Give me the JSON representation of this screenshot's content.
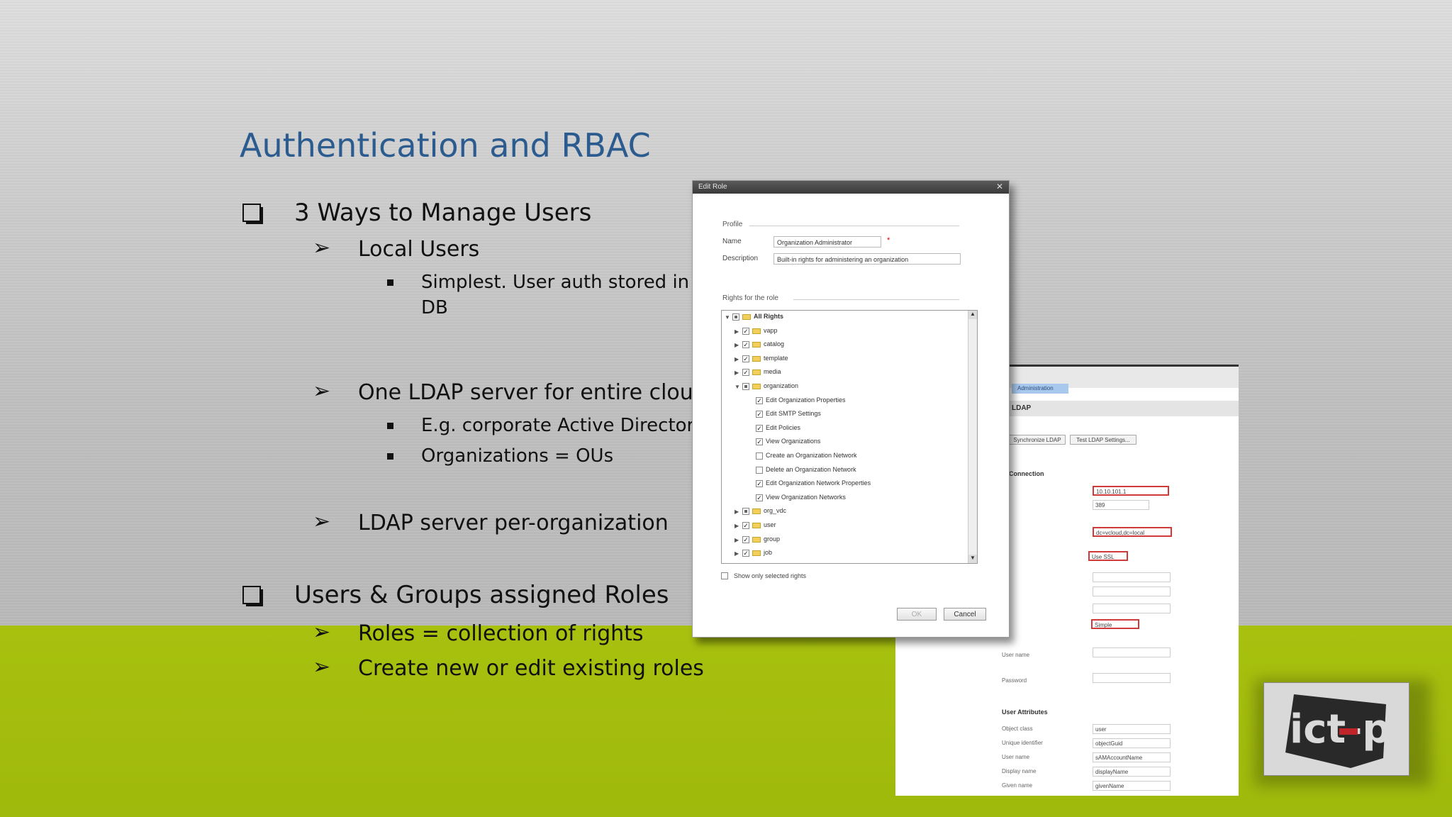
{
  "slide": {
    "title": "Authentication and RBAC",
    "items": [
      {
        "level": 1,
        "text": "3 Ways to Manage Users"
      },
      {
        "level": 2,
        "text": "Local Users"
      },
      {
        "level": 3,
        "text": "Simplest.  User auth stored in DB"
      },
      {
        "level": 2,
        "text": "One LDAP server for entire cloud"
      },
      {
        "level": 3,
        "text": "E.g. corporate Active Directory"
      },
      {
        "level": 3,
        "text": "Organizations = OUs"
      },
      {
        "level": 2,
        "text": "LDAP server per-organization"
      },
      {
        "level": 1,
        "text": "Users & Groups assigned Roles"
      },
      {
        "level": 2,
        "text": "Roles = collection of rights"
      },
      {
        "level": 2,
        "text": "Create new or edit existing roles"
      }
    ],
    "l3_line1": "Simplest.  User auth stored in",
    "l3_line2": "DB"
  },
  "edit_role_dialog": {
    "title": "Edit Role",
    "profile_section": "Profile",
    "name_label": "Name",
    "name_value": "Organization Administrator",
    "description_label": "Description",
    "description_value": "Built-in rights for administering an organization",
    "rights_section": "Rights for the role",
    "tree": [
      {
        "label": "All Rights",
        "depth": 0,
        "expanded": true,
        "state": "partial",
        "folder": true,
        "bold": true
      },
      {
        "label": "vapp",
        "depth": 1,
        "expanded": false,
        "state": "checked",
        "folder": true
      },
      {
        "label": "catalog",
        "depth": 1,
        "expanded": false,
        "state": "checked",
        "folder": true
      },
      {
        "label": "template",
        "depth": 1,
        "expanded": false,
        "state": "checked",
        "folder": true
      },
      {
        "label": "media",
        "depth": 1,
        "expanded": false,
        "state": "checked",
        "folder": true
      },
      {
        "label": "organization",
        "depth": 1,
        "expanded": true,
        "state": "partial",
        "folder": true
      },
      {
        "label": "Edit Organization Properties",
        "depth": 2,
        "state": "checked"
      },
      {
        "label": "Edit SMTP Settings",
        "depth": 2,
        "state": "checked"
      },
      {
        "label": "Edit Policies",
        "depth": 2,
        "state": "checked"
      },
      {
        "label": "View Organizations",
        "depth": 2,
        "state": "checked"
      },
      {
        "label": "Create an Organization Network",
        "depth": 2,
        "state": "unchecked"
      },
      {
        "label": "Delete an Organization Network",
        "depth": 2,
        "state": "unchecked"
      },
      {
        "label": "Edit Organization Network Properties",
        "depth": 2,
        "state": "checked"
      },
      {
        "label": "View Organization Networks",
        "depth": 2,
        "state": "checked"
      },
      {
        "label": "org_vdc",
        "depth": 1,
        "expanded": false,
        "state": "partial",
        "folder": true
      },
      {
        "label": "user",
        "depth": 1,
        "expanded": false,
        "state": "checked",
        "folder": true
      },
      {
        "label": "group",
        "depth": 1,
        "expanded": false,
        "state": "checked",
        "folder": true
      },
      {
        "label": "job",
        "depth": 1,
        "expanded": false,
        "state": "checked",
        "folder": true
      }
    ],
    "show_selected_label": "Show only selected rights",
    "ok_label": "OK",
    "cancel_label": "Cancel"
  },
  "ldap_panel": {
    "tab_label": "Administration",
    "header": "LDAP",
    "button1": "Synchronize LDAP",
    "button2": "Test LDAP Settings...",
    "connection_section": "Connection",
    "server_value": "10.10.101.1",
    "port_value": "389",
    "base_dn_value": "dc=vcloud,dc=local",
    "ssl_label": "Use SSL",
    "auth_method_value": "Simple",
    "user_name_label": "User name",
    "password_label": "Password",
    "user_attributes_section": "User Attributes",
    "attributes": [
      {
        "label": "Object class",
        "value": "user"
      },
      {
        "label": "Unique identifier",
        "value": "objectGuid"
      },
      {
        "label": "User name",
        "value": "sAMAccountName"
      },
      {
        "label": "Display name",
        "value": "displayName"
      },
      {
        "label": "Given name",
        "value": "givenName"
      }
    ]
  },
  "logo": {
    "text": "ict-p"
  },
  "colors": {
    "title": "#2b5b8f",
    "green_band": "#a4be0e"
  }
}
